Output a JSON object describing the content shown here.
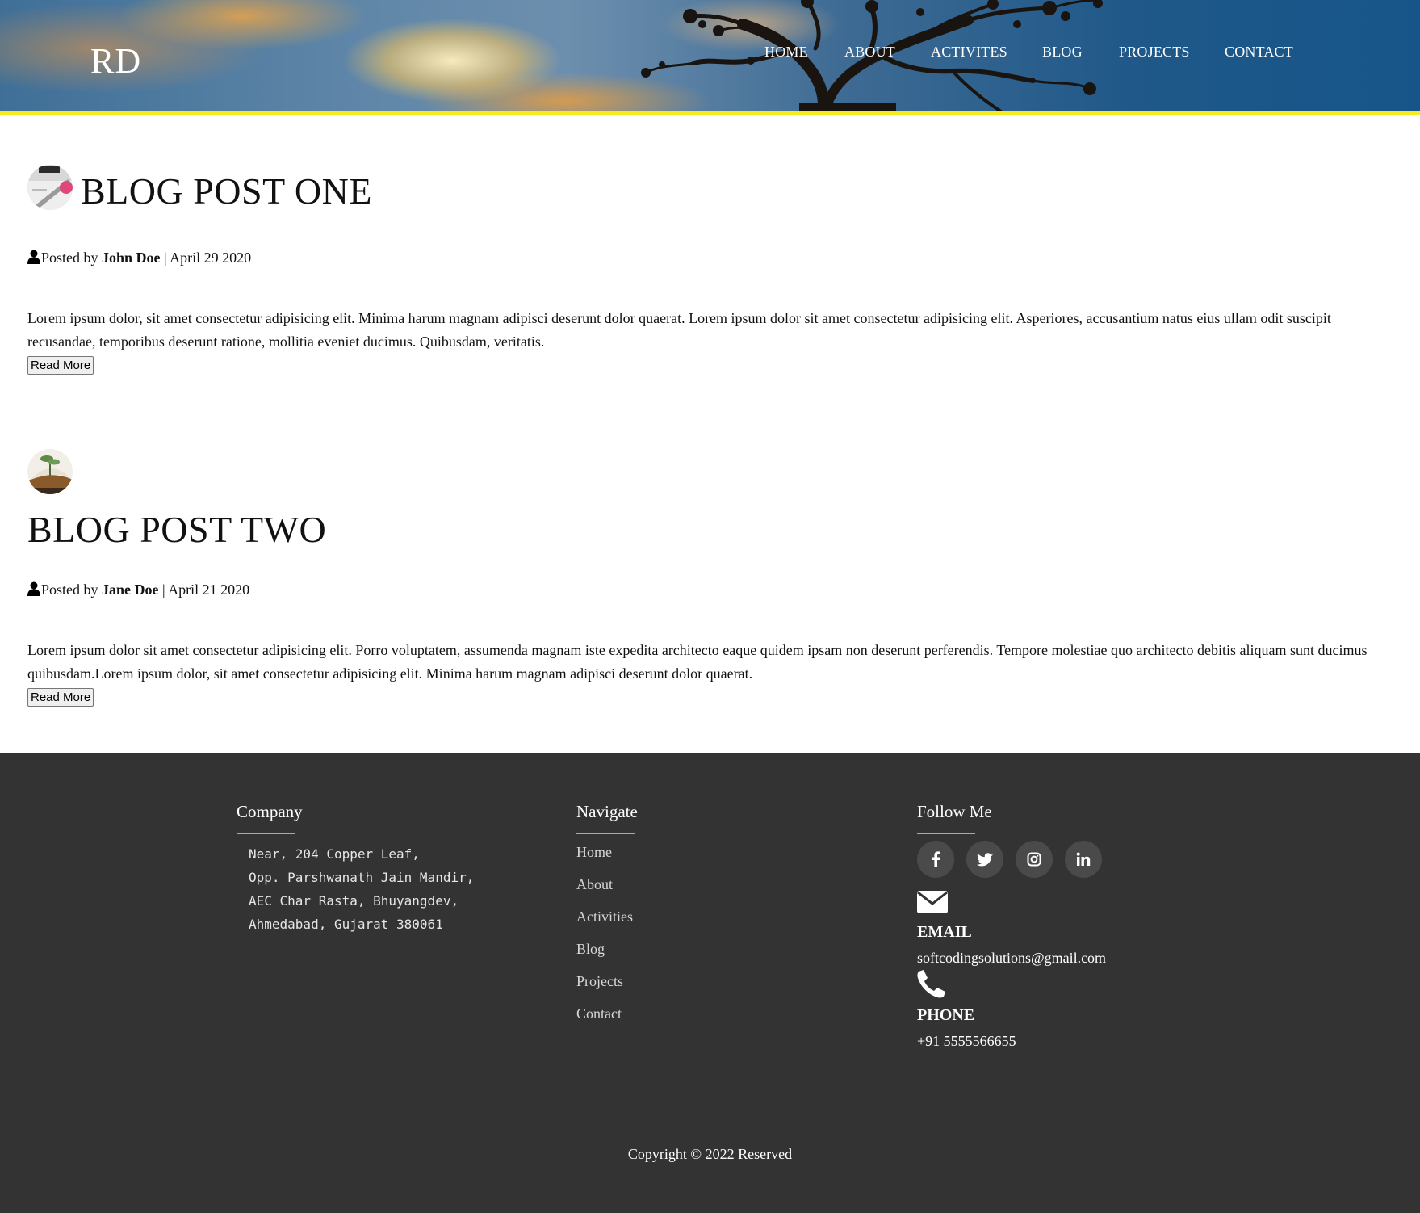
{
  "header": {
    "logo": "RD",
    "nav": [
      {
        "label": "HOME"
      },
      {
        "label": "ABOUT"
      },
      {
        "label": "ACTIVITES"
      },
      {
        "label": "BLOG"
      },
      {
        "label": "PROJECTS"
      },
      {
        "label": "CONTACT"
      }
    ],
    "accent_border_color": "#f5ec1d"
  },
  "posts": [
    {
      "title": "BLOG POST ONE",
      "posted_by_prefix": "Posted by",
      "author": "John Doe",
      "separator": "|",
      "date": "April 29 2020",
      "excerpt_line1": "Lorem ipsum dolor, sit amet consectetur adipisicing elit. Minima harum magnam adipisci deserunt dolor quaerat. Lorem ipsum dolor sit amet consectetur adipisicing elit. Asperiores, accusantium natus eius ullam odit suscipit",
      "excerpt_line2": "recusandae, temporibus deserunt ratione, mollitia eveniet ducimus. Quibusdam, veritatis.",
      "button": "Read More",
      "user_icon": "user-icon"
    },
    {
      "title": "BLOG POST TWO",
      "posted_by_prefix": "Posted by",
      "author": "Jane Doe",
      "separator": "|",
      "date": "April 21 2020",
      "excerpt_line1": "Lorem ipsum dolor sit amet consectetur adipisicing elit. Porro voluptatem, assumenda magnam iste expedita architecto eaque quidem ipsam non deserunt perferendis. Tempore molestiae quo architecto debitis aliquam sunt ducimus",
      "excerpt_line2": "quibusdam.Lorem ipsum dolor, sit amet consectetur adipisicing elit. Minima harum magnam adipisci deserunt dolor quaerat.",
      "button": "Read More",
      "user_icon": "user-icon"
    }
  ],
  "footer": {
    "background": "#333333",
    "underline_color": "#e0a526",
    "company": {
      "heading": "Company",
      "address": [
        "Near, 204 Copper Leaf,",
        "Opp. Parshwanath Jain Mandir,",
        "AEC Char Rasta, Bhuyangdev,",
        "Ahmedabad, Gujarat 380061"
      ]
    },
    "navigate": {
      "heading": "Navigate",
      "links": [
        "Home",
        "About",
        "Activities",
        "Blog",
        "Projects",
        "Contact"
      ]
    },
    "follow": {
      "heading": "Follow Me",
      "social": [
        "facebook-icon",
        "twitter-icon",
        "instagram-icon",
        "linkedin-icon"
      ],
      "email_label": "EMAIL",
      "email": "softcodingsolutions@gmail.com",
      "phone_label": "PHONE",
      "phone": "+91 5555566655"
    },
    "copyright": "Copyright © 2022 Reserved"
  }
}
